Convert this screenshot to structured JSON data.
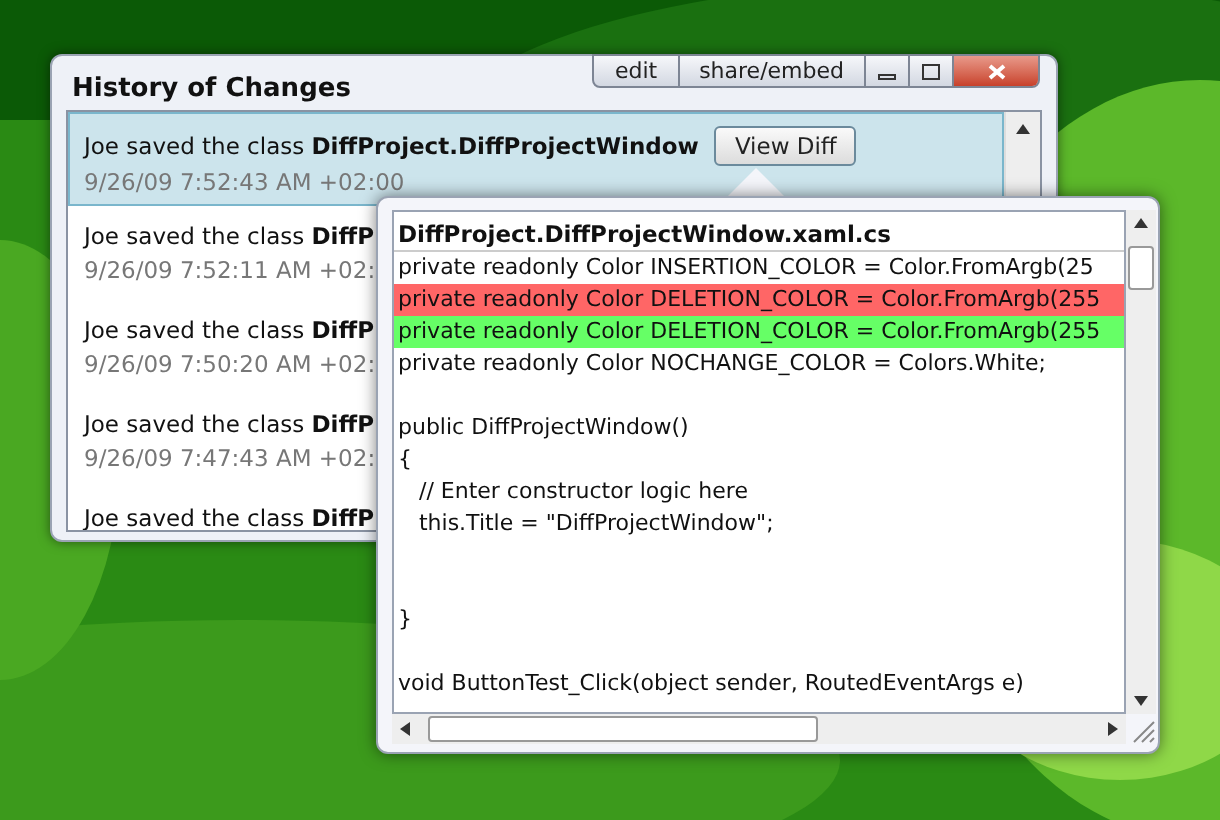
{
  "window": {
    "title": "History of Changes",
    "buttons": [
      "edit",
      "share/embed"
    ]
  },
  "history": [
    {
      "text": "Joe saved the class **DiffProject.DiffProjectWindow**",
      "time": "9/26/09 7:52:43 AM +02:00",
      "selected": true,
      "button": "View Diff"
    },
    {
      "text": "Joe saved the class **DiffP**",
      "time": "9/26/09 7:52:11 AM +02:",
      "selected": false
    },
    {
      "text": "Joe saved the class **DiffP**",
      "time": "9/26/09 7:50:20 AM +02:",
      "selected": false
    },
    {
      "text": "Joe saved the class **DiffP**",
      "time": "9/26/09 7:47:43 AM +02:",
      "selected": false
    },
    {
      "text": "Joe saved the class **DiffP**",
      "selected": false
    }
  ],
  "diff": {
    "title": "DiffProject.DiffProjectWindow.xaml.cs",
    "lines": [
      {
        "kind": "normal",
        "text": "private readonly Color INSERTION_COLOR = Color.FromArgb(25"
      },
      {
        "kind": "deleted",
        "text": "private readonly Color DELETION_COLOR = Color.FromArgb(255"
      },
      {
        "kind": "inserted",
        "text": "private readonly Color DELETION_COLOR = Color.FromArgb(255"
      },
      {
        "kind": "normal",
        "text": "private readonly Color NOCHANGE_COLOR = Colors.White;"
      },
      {
        "kind": "blank"
      },
      {
        "kind": "normal",
        "text": "public DiffProjectWindow()"
      },
      {
        "kind": "normal",
        "text": "{"
      },
      {
        "kind": "normal",
        "text": "   // Enter constructor logic here"
      },
      {
        "kind": "normal",
        "text": "   this.Title = \"DiffProjectWindow\";"
      },
      {
        "kind": "blank"
      },
      {
        "kind": "blank"
      },
      {
        "kind": "normal",
        "text": "}"
      },
      {
        "kind": "blank"
      },
      {
        "kind": "normal",
        "text": "void ButtonTest_Click(object sender, RoutedEventArgs e)"
      }
    ]
  }
}
